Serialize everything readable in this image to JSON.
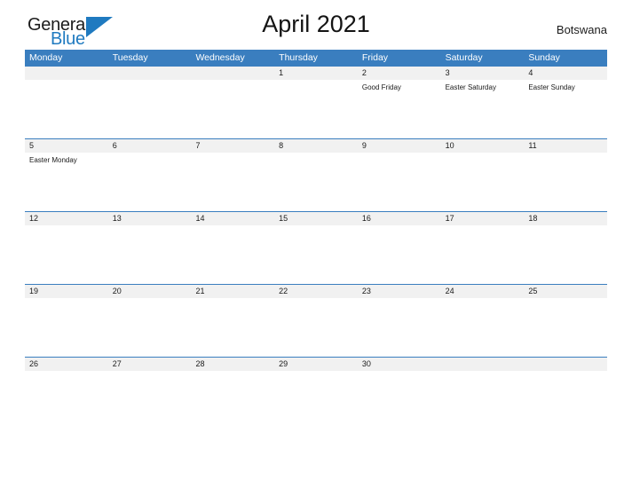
{
  "brand": {
    "name_part1": "General",
    "name_part2": "Blue",
    "primary_color": "#1f7ac0"
  },
  "header": {
    "title": "April 2021",
    "country": "Botswana",
    "header_bar_color": "#3a7ebf",
    "date_band_color": "#f1f1f1"
  },
  "weekdays": [
    "Monday",
    "Tuesday",
    "Wednesday",
    "Thursday",
    "Friday",
    "Saturday",
    "Sunday"
  ],
  "weeks": [
    {
      "days": [
        {
          "date": "",
          "event": ""
        },
        {
          "date": "",
          "event": ""
        },
        {
          "date": "",
          "event": ""
        },
        {
          "date": "1",
          "event": ""
        },
        {
          "date": "2",
          "event": "Good Friday"
        },
        {
          "date": "3",
          "event": "Easter Saturday"
        },
        {
          "date": "4",
          "event": "Easter Sunday"
        }
      ]
    },
    {
      "days": [
        {
          "date": "5",
          "event": "Easter Monday"
        },
        {
          "date": "6",
          "event": ""
        },
        {
          "date": "7",
          "event": ""
        },
        {
          "date": "8",
          "event": ""
        },
        {
          "date": "9",
          "event": ""
        },
        {
          "date": "10",
          "event": ""
        },
        {
          "date": "11",
          "event": ""
        }
      ]
    },
    {
      "days": [
        {
          "date": "12",
          "event": ""
        },
        {
          "date": "13",
          "event": ""
        },
        {
          "date": "14",
          "event": ""
        },
        {
          "date": "15",
          "event": ""
        },
        {
          "date": "16",
          "event": ""
        },
        {
          "date": "17",
          "event": ""
        },
        {
          "date": "18",
          "event": ""
        }
      ]
    },
    {
      "days": [
        {
          "date": "19",
          "event": ""
        },
        {
          "date": "20",
          "event": ""
        },
        {
          "date": "21",
          "event": ""
        },
        {
          "date": "22",
          "event": ""
        },
        {
          "date": "23",
          "event": ""
        },
        {
          "date": "24",
          "event": ""
        },
        {
          "date": "25",
          "event": ""
        }
      ]
    },
    {
      "days": [
        {
          "date": "26",
          "event": ""
        },
        {
          "date": "27",
          "event": ""
        },
        {
          "date": "28",
          "event": ""
        },
        {
          "date": "29",
          "event": ""
        },
        {
          "date": "30",
          "event": ""
        },
        {
          "date": "",
          "event": ""
        },
        {
          "date": "",
          "event": ""
        }
      ]
    }
  ]
}
